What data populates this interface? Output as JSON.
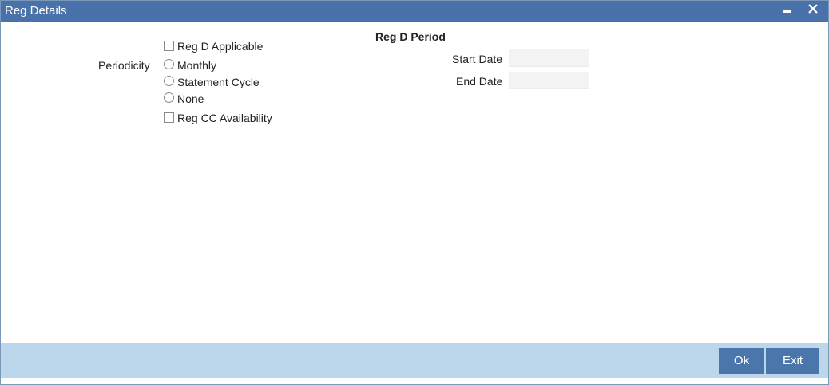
{
  "window": {
    "title": "Reg Details"
  },
  "titlebar": {
    "minimize_icon": "minimize-icon",
    "close_icon": "close-icon"
  },
  "form": {
    "reg_d_applicable": {
      "label": "Reg D Applicable",
      "checked": false
    },
    "periodicity": {
      "label": "Periodicity",
      "options": [
        {
          "label": "Monthly",
          "selected": false
        },
        {
          "label": "Statement Cycle",
          "selected": false
        },
        {
          "label": "None",
          "selected": false
        }
      ]
    },
    "reg_cc_availability": {
      "label": "Reg CC Availability",
      "checked": false
    }
  },
  "reg_d_period": {
    "title": "Reg D Period",
    "start_date": {
      "label": "Start Date",
      "value": ""
    },
    "end_date": {
      "label": "End Date",
      "value": ""
    }
  },
  "footer": {
    "ok_label": "Ok",
    "exit_label": "Exit"
  },
  "colors": {
    "titlebar": "#4872a9",
    "footer": "#bcd7ec",
    "button": "#4a76ac"
  }
}
